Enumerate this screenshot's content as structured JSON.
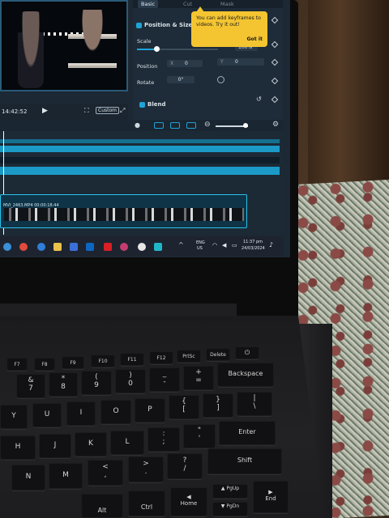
{
  "preview": {
    "timecode": "14:42:52",
    "fit_label": "Custom"
  },
  "panel": {
    "tabs": [
      "Basic",
      "Cut",
      "Mask"
    ],
    "section_position": "Position & Size",
    "scale_label": "Scale",
    "scale_value": "100%",
    "position_label": "Position",
    "x_label": "X",
    "x_value": "0",
    "y_label": "Y",
    "y_value": "0",
    "rotate_label": "Rotate",
    "rotate_value": "0°",
    "section_blend": "Blend"
  },
  "tooltip": {
    "message": "You can add keyframes to videos. Try it out!",
    "action": "Got it"
  },
  "timeline": {
    "clip_label": "MVI_2463.MP4   00:00:18:44"
  },
  "taskbar": {
    "lang_top": "ENG",
    "lang_bottom": "US",
    "time": "11:37 pm",
    "date": "24/03/2024"
  },
  "keyboard": {
    "fn_row": [
      "F7",
      "F8",
      "F9",
      "F10",
      "F11",
      "F12",
      "PrtSc",
      "Delete"
    ],
    "num_row": [
      {
        "top": "&",
        "bottom": "7"
      },
      {
        "top": "*",
        "bottom": "8"
      },
      {
        "top": "(",
        "bottom": "9"
      },
      {
        "top": ")",
        "bottom": "0"
      },
      {
        "top": "_",
        "bottom": "-"
      },
      {
        "top": "+",
        "bottom": "="
      }
    ],
    "backspace": "Backspace",
    "q_row": [
      "Y",
      "U",
      "I",
      "O",
      "P"
    ],
    "brace_open": "{",
    "bracket_open": "[",
    "brace_close": "}",
    "bracket_close": "]",
    "pipe": "|",
    "backslash": "\\",
    "a_row": [
      "H",
      "J",
      "K",
      "L"
    ],
    "colon": ":",
    "semicolon": ";",
    "quote_top": "\"",
    "quote_bottom": "'",
    "enter": "Enter",
    "z_row": [
      "N",
      "M"
    ],
    "lt": "<",
    "comma": ",",
    "gt": ">",
    "period": ".",
    "question": "?",
    "slash": "/",
    "shift": "Shift",
    "alt": "Alt",
    "ctrl": "Ctrl",
    "home": "Home",
    "pgup": "PgUp",
    "pgdn": "PgDn",
    "end": "End"
  }
}
